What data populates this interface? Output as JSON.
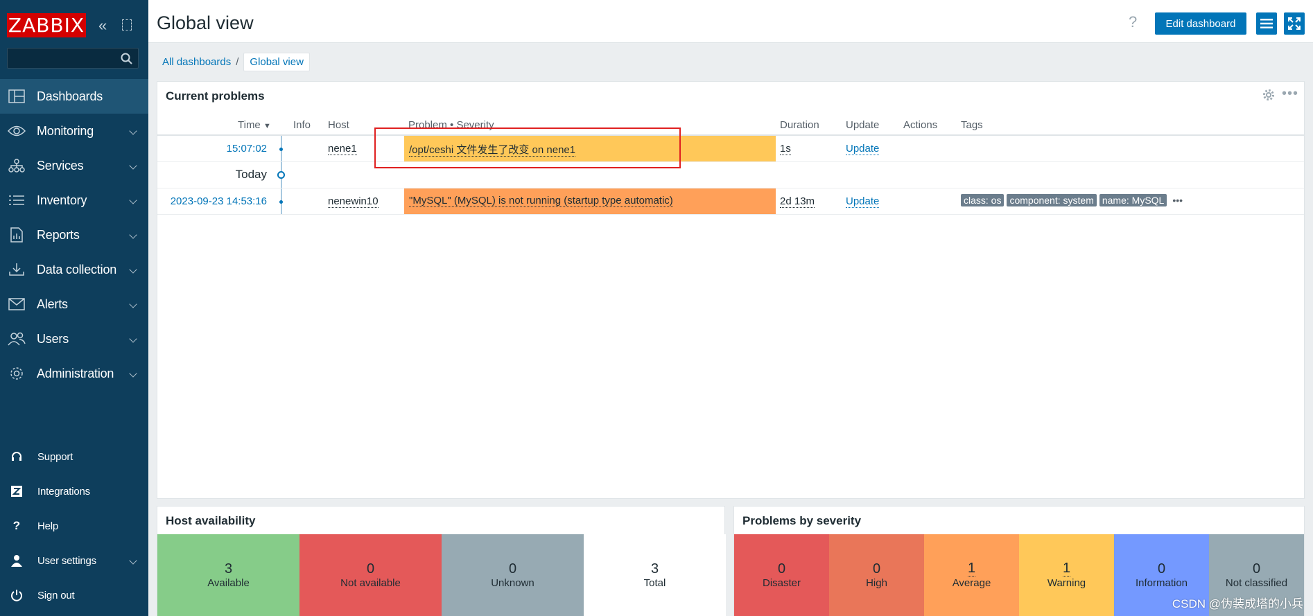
{
  "sidebar": {
    "logo": "ZABBIX",
    "search_placeholder": "",
    "menu": [
      {
        "label": "Dashboards",
        "icon": "dashboard-icon",
        "active": true
      },
      {
        "label": "Monitoring",
        "icon": "eye-icon"
      },
      {
        "label": "Services",
        "icon": "services-icon"
      },
      {
        "label": "Inventory",
        "icon": "list-icon"
      },
      {
        "label": "Reports",
        "icon": "report-icon"
      },
      {
        "label": "Data collection",
        "icon": "download-icon"
      },
      {
        "label": "Alerts",
        "icon": "envelope-icon"
      },
      {
        "label": "Users",
        "icon": "users-icon"
      },
      {
        "label": "Administration",
        "icon": "gear-icon"
      }
    ],
    "bottom": [
      {
        "label": "Support",
        "icon": "headset-icon"
      },
      {
        "label": "Integrations",
        "icon": "z-icon"
      },
      {
        "label": "Help",
        "icon": "question-icon"
      },
      {
        "label": "User settings",
        "icon": "user-icon"
      },
      {
        "label": "Sign out",
        "icon": "power-icon"
      }
    ]
  },
  "header": {
    "title": "Global view",
    "help": "?",
    "edit_button": "Edit dashboard"
  },
  "breadcrumb": {
    "parent": "All dashboards",
    "separator": "/",
    "current": "Global view"
  },
  "problems_widget": {
    "title": "Current problems",
    "columns": {
      "time": "Time",
      "info": "Info",
      "host": "Host",
      "problem": "Problem • Severity",
      "duration": "Duration",
      "update": "Update",
      "actions": "Actions",
      "tags": "Tags"
    },
    "today_label": "Today",
    "rows": [
      {
        "time": "15:07:02",
        "host": "nene1",
        "problem": "/opt/ceshi 文件发生了改变 on nene1",
        "severity_color": "#ffc859",
        "duration": "1s",
        "update": "Update",
        "tags": []
      },
      {
        "time": "2023-09-23 14:53:16",
        "host": "nenewin10",
        "problem": "\"MySQL\" (MySQL) is not running (startup type automatic)",
        "severity_color": "#ffa059",
        "duration": "2d 13m",
        "update": "Update",
        "tags": [
          "class: os",
          "component: system",
          "name: MySQL"
        ],
        "more": "•••"
      }
    ]
  },
  "host_availability": {
    "title": "Host availability",
    "tiles": [
      {
        "value": "3",
        "label": "Available",
        "color": "#86cc89"
      },
      {
        "value": "0",
        "label": "Not available",
        "color": "#e45959"
      },
      {
        "value": "0",
        "label": "Unknown",
        "color": "#97aab3"
      },
      {
        "value": "3",
        "label": "Total",
        "color": "#ffffff"
      }
    ]
  },
  "problems_by_severity": {
    "title": "Problems by severity",
    "tiles": [
      {
        "value": "0",
        "label": "Disaster",
        "color": "#e45959"
      },
      {
        "value": "0",
        "label": "High",
        "color": "#e97659"
      },
      {
        "value": "1",
        "label": "Average",
        "color": "#ffa059"
      },
      {
        "value": "1",
        "label": "Warning",
        "color": "#ffc859"
      },
      {
        "value": "0",
        "label": "Information",
        "color": "#7499ff"
      },
      {
        "value": "0",
        "label": "Not classified",
        "color": "#97aab3"
      }
    ]
  },
  "watermark": "CSDN @伪装成塔的小兵"
}
